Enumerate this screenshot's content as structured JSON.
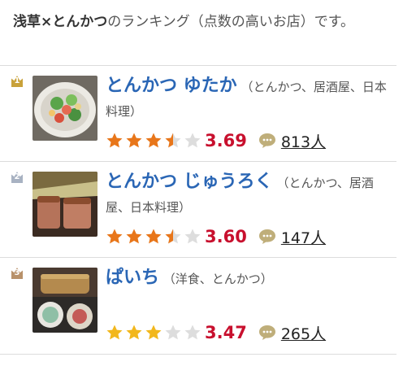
{
  "intro": {
    "bold": "浅草×とんかつ",
    "rest": "のランキング（点数の高いお店）です。"
  },
  "colors": {
    "name_blue": "#2a66b5",
    "score_red": "#c8102e",
    "star_orange": "#e8761a",
    "star_gold": "#f2b71c",
    "star_empty": "#dddddd",
    "rank1": "#c9a23a",
    "rank2": "#a8b2c2",
    "rank3": "#b8916a"
  },
  "restaurants": [
    {
      "rank": "1",
      "name": "とんかつ ゆたか",
      "genre": "（とんかつ、居酒屋、日本料理）",
      "rating": 3.69,
      "score": "3.69",
      "reviews": "813人",
      "photo_icon": "salad-photo"
    },
    {
      "rank": "2",
      "name": "とんかつ じゅうろく",
      "genre": "（とんかつ、居酒屋、日本料理）",
      "rating": 3.6,
      "score": "3.60",
      "reviews": "147人",
      "photo_icon": "tonkatsu-photo"
    },
    {
      "rank": "3",
      "name": "ぱいち",
      "genre": "（洋食、とんかつ）",
      "rating": 3.47,
      "score": "3.47",
      "reviews": "265人",
      "photo_icon": "set-meal-photo"
    }
  ]
}
